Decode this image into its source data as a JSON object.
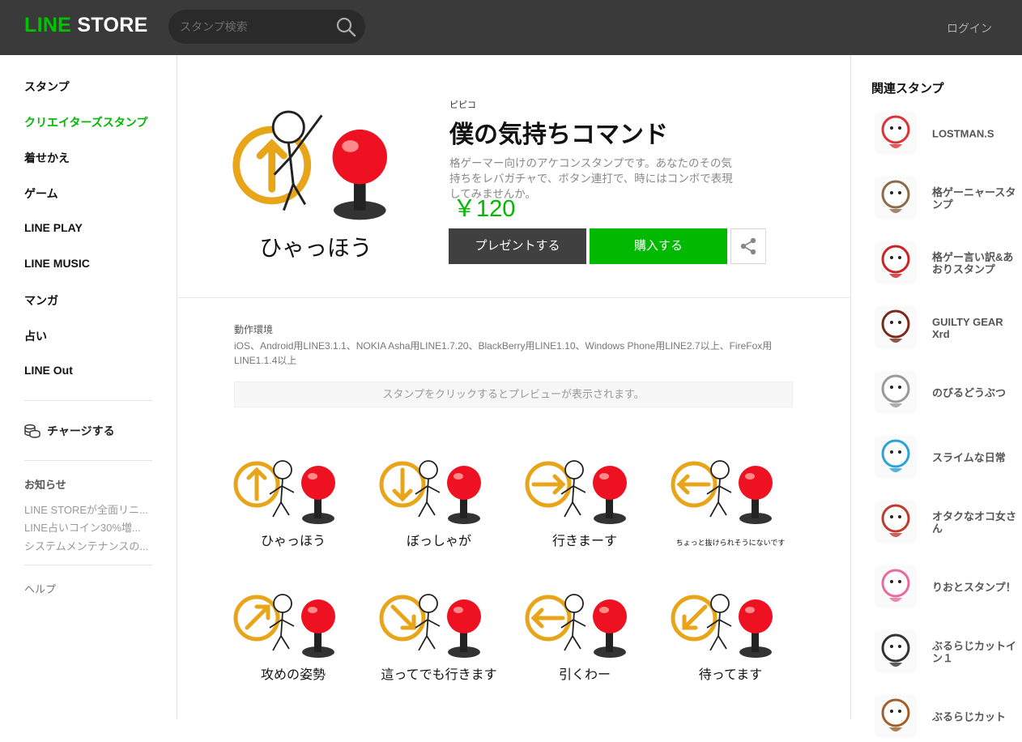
{
  "header": {
    "logo_line": "LINE",
    "logo_store": "STORE",
    "search_placeholder": "スタンプ検索",
    "login": "ログイン"
  },
  "sidebar": {
    "nav": [
      "スタンプ",
      "クリエイターズスタンプ",
      "着せかえ",
      "ゲーム",
      "LINE PLAY",
      "LINE MUSIC",
      "マンガ",
      "占い",
      "LINE Out"
    ],
    "active_index": 1,
    "charge": "チャージする",
    "notice_title": "お知らせ",
    "notices": [
      "LINE STOREが全面リニ...",
      "LINE占いコイン30%増...",
      "システムメンテナンスの..."
    ],
    "help": "ヘルプ"
  },
  "product": {
    "author": "ピピコ",
    "title": "僕の気持ちコマンド",
    "description": "格ゲーマー向けのアケコンスタンプです。あなたのその気持ちをレバガチャで、ボタン連打で、時にはコンボで表現してみませんか。",
    "price": "￥120",
    "present_button": "プレゼントする",
    "buy_button": "購入する",
    "main_caption": "ひゃっほう"
  },
  "environment": {
    "title": "動作環境",
    "text": "iOS、Android用LINE3.1.1、NOKIA Asha用LINE1.7.20、BlackBerry用LINE1.10、Windows Phone用LINE2.7以上、FireFox用LINE1.1.4以上"
  },
  "preview_hint": "スタンプをクリックするとプレビューが表示されます。",
  "stickers": [
    {
      "caption": "ひゃっほう",
      "arrow": "up"
    },
    {
      "caption": "ぼっしゃが",
      "arrow": "down"
    },
    {
      "caption": "行きまーす",
      "arrow": "right"
    },
    {
      "caption": "ちょっと抜けられそうにないです",
      "arrow": "left"
    },
    {
      "caption": "攻めの姿勢",
      "arrow": "up-right"
    },
    {
      "caption": "這ってでも行きます",
      "arrow": "down-right"
    },
    {
      "caption": "引くわー",
      "arrow": "left"
    },
    {
      "caption": "待ってます",
      "arrow": "down-left"
    }
  ],
  "related": {
    "title": "関連スタンプ",
    "items": [
      {
        "name": "LOSTMAN.S",
        "color": "#d33"
      },
      {
        "name": "格ゲーニャースタンプ",
        "color": "#8a6b4a"
      },
      {
        "name": "格ゲー言い訳&あおりスタンプ",
        "color": "#c22"
      },
      {
        "name": "GUILTY GEAR Xrd",
        "color": "#7a2a1a"
      },
      {
        "name": "のびるどうぶつ",
        "color": "#999"
      },
      {
        "name": "スライムな日常",
        "color": "#2aa3d8"
      },
      {
        "name": "オタクなオコ女さん",
        "color": "#c0392b"
      },
      {
        "name": "りおとスタンプ！",
        "color": "#e86aa0"
      },
      {
        "name": "ぶるらじカットイン１",
        "color": "#333"
      },
      {
        "name": "ぶるらじカット",
        "color": "#a0602a"
      }
    ]
  }
}
